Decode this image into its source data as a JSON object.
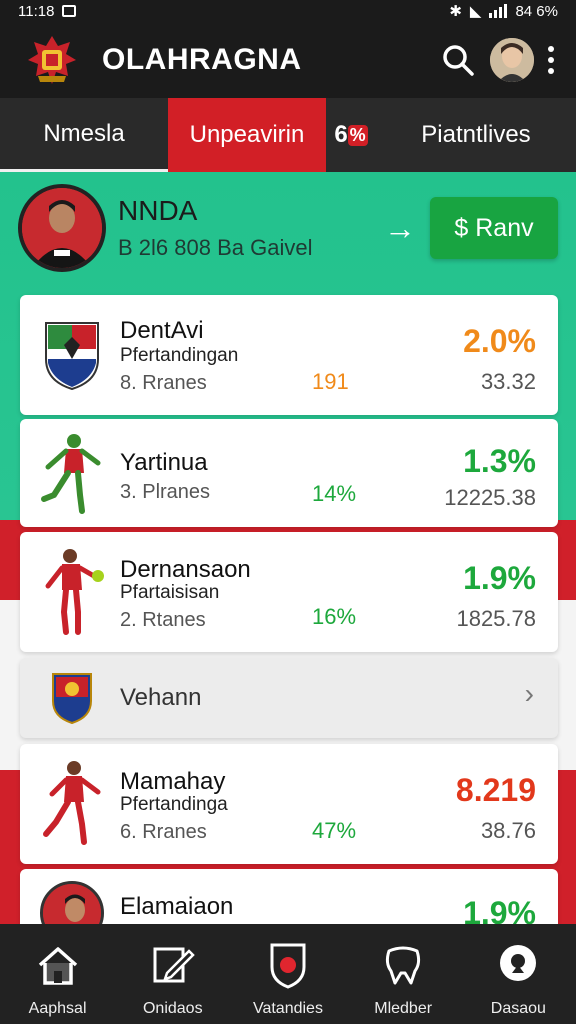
{
  "status_bar": {
    "time": "11:18",
    "battery": "84 6%"
  },
  "header": {
    "title": "OLAHRAGNA"
  },
  "tabs": [
    {
      "label": "Nmesla"
    },
    {
      "label": "Unpeavirin"
    },
    {
      "label": "6",
      "badge": "%"
    },
    {
      "label": "Piatntlives"
    }
  ],
  "profile": {
    "name": "NNDA",
    "subtitle": "B 2l6 808  Ba Gaivel",
    "arrow": "→",
    "button": "$ Ranv"
  },
  "cards": [
    {
      "title": "DentAvi",
      "subtitle": "Pfertandingan",
      "meta": "8. Rranes",
      "mid": "191",
      "pct": "2.0%",
      "value": "33.32"
    },
    {
      "title": "Yartinua",
      "subtitle": "",
      "meta": "3. Plranes",
      "mid": "14%",
      "pct": "1.3%",
      "value": "12225.38"
    },
    {
      "title": "Dernansaon",
      "subtitle": "Pfartaisisan",
      "meta": "2. Rtanes",
      "mid": "16%",
      "pct": "1.9%",
      "value": "1825.78"
    },
    {
      "title": "Vehann",
      "chevron": "›"
    },
    {
      "title": "Mamahay",
      "subtitle": "Pfertandinga",
      "meta": "6. Rranes",
      "mid": "47%",
      "pct": "8.219",
      "value": "38.76"
    },
    {
      "title": "Elamaiaon",
      "pct": "1.9%"
    }
  ],
  "bottom_nav": [
    {
      "label": "Aaphsal",
      "icon": "home-icon"
    },
    {
      "label": "Onidaos",
      "icon": "edit-icon"
    },
    {
      "label": "Vatandies",
      "icon": "shield-icon"
    },
    {
      "label": "Mledber",
      "icon": "tooth-icon"
    },
    {
      "label": "Dasaou",
      "icon": "location-icon"
    }
  ],
  "colors": {
    "green_bg": "#23c28d",
    "red": "#d21f26",
    "button_green": "#18a441",
    "orange": "#f08a1a"
  }
}
